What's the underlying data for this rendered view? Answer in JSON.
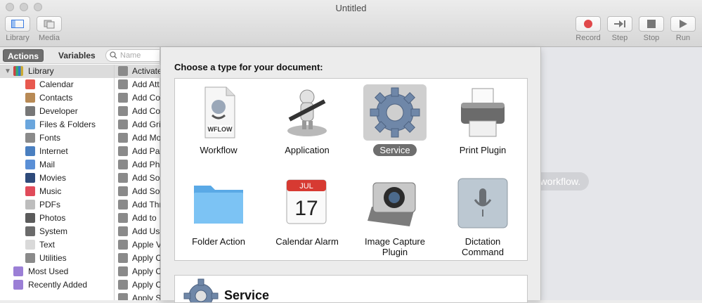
{
  "window": {
    "title": "Untitled"
  },
  "toolbar": {
    "left": [
      {
        "label": "Library",
        "icon": "library-icon"
      },
      {
        "label": "Media",
        "icon": "media-icon"
      }
    ],
    "right": [
      {
        "label": "Record",
        "icon": "record-icon",
        "color": "#e0484a"
      },
      {
        "label": "Step",
        "icon": "step-icon"
      },
      {
        "label": "Stop",
        "icon": "stop-icon"
      },
      {
        "label": "Run",
        "icon": "run-icon"
      }
    ]
  },
  "sidebar": {
    "tabs": [
      {
        "label": "Actions",
        "active": true
      },
      {
        "label": "Variables",
        "active": false
      }
    ],
    "search_placeholder": "Name",
    "library_root": "Library",
    "items": [
      {
        "label": "Calendar",
        "color": "#e8594f"
      },
      {
        "label": "Contacts",
        "color": "#b88a55"
      },
      {
        "label": "Developer",
        "color": "#777777"
      },
      {
        "label": "Files & Folders",
        "color": "#6aa6dd"
      },
      {
        "label": "Fonts",
        "color": "#8a8a8a"
      },
      {
        "label": "Internet",
        "color": "#4a7fc0"
      },
      {
        "label": "Mail",
        "color": "#5a8fd6"
      },
      {
        "label": "Movies",
        "color": "#2e4a7a"
      },
      {
        "label": "Music",
        "color": "#e04b5a"
      },
      {
        "label": "PDFs",
        "color": "#bdbdbd"
      },
      {
        "label": "Photos",
        "color": "#5b5b5b"
      },
      {
        "label": "System",
        "color": "#6b6b6b"
      },
      {
        "label": "Text",
        "color": "#d9d9d9"
      },
      {
        "label": "Utilities",
        "color": "#8a8a8a"
      }
    ],
    "smart_groups": [
      {
        "label": "Most Used",
        "color": "#9b7fd6"
      },
      {
        "label": "Recently Added",
        "color": "#9b7fd6"
      }
    ],
    "actions": [
      "Activate",
      "Add Att",
      "Add Co",
      "Add Co",
      "Add Gri",
      "Add Mo",
      "Add Pa",
      "Add Ph",
      "Add So",
      "Add So",
      "Add Thr",
      "Add to",
      "Add Us",
      "Apple V",
      "Apply C",
      "Apply C",
      "Apply C",
      "Apply S"
    ]
  },
  "chooser": {
    "prompt": "Choose a type for your document:",
    "types": [
      {
        "label": "Workflow",
        "art": "wflow-doc-icon",
        "badge": "WFLOW",
        "selected": false
      },
      {
        "label": "Application",
        "art": "robot-icon",
        "selected": false
      },
      {
        "label": "Service",
        "art": "gear-icon",
        "selected": true
      },
      {
        "label": "Print Plugin",
        "art": "printer-icon",
        "selected": false
      },
      {
        "label": "Folder Action",
        "art": "folder-icon",
        "selected": false
      },
      {
        "label": "Calendar Alarm",
        "art": "calendar-icon",
        "month": "JUL",
        "day": "17",
        "selected": false
      },
      {
        "label": "Image Capture\nPlugin",
        "art": "camera-icon",
        "selected": false
      },
      {
        "label": "Dictation\nCommand",
        "art": "microphone-icon",
        "selected": false
      }
    ],
    "description_title": "Service"
  },
  "workflow_area": {
    "hint": "r workflow."
  }
}
